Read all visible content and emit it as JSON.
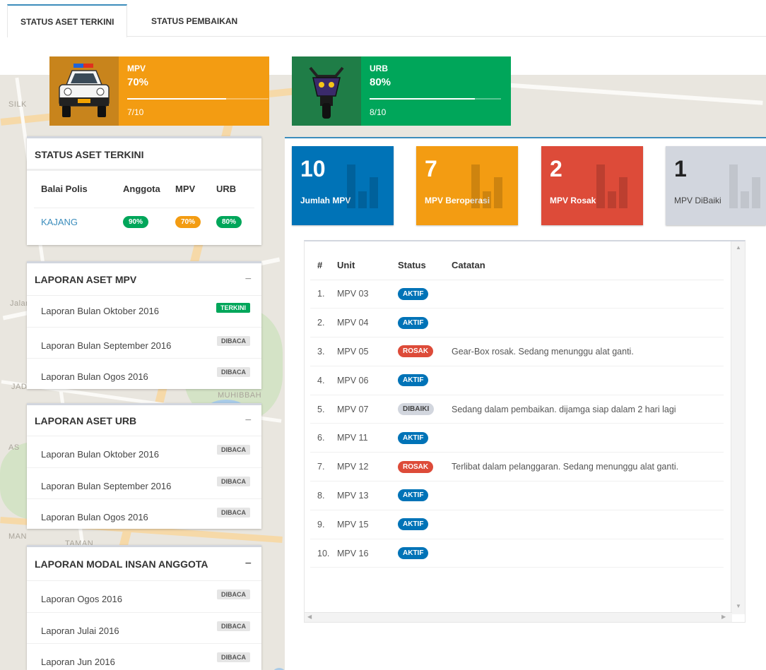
{
  "tabs": [
    {
      "label": "STATUS ASET TERKINI",
      "active": true
    },
    {
      "label": "STATUS PEMBAIKAN",
      "active": false
    }
  ],
  "asset_progress": [
    {
      "name": "MPV",
      "percent_label": "70%",
      "ratio": "7/10",
      "fill": 0.7,
      "color": "#f39c12",
      "icon_color": "#c8841c",
      "icon": "police-car-icon"
    },
    {
      "name": "URB",
      "percent_label": "80%",
      "ratio": "8/10",
      "fill": 0.8,
      "color": "#00a65a",
      "icon_color": "#1f7d47",
      "icon": "motorcycle-icon"
    }
  ],
  "status_panel": {
    "title": "STATUS ASET TERKINI",
    "headers": [
      "Balai Polis",
      "Anggota",
      "MPV",
      "URB"
    ],
    "rows": [
      {
        "station": "KAJANG",
        "anggota": "90%",
        "mpv": "70%",
        "urb": "80%"
      }
    ]
  },
  "report_panels": [
    {
      "title": "LAPORAN ASET MPV",
      "items": [
        {
          "label": "Laporan Bulan Oktober 2016",
          "badge": "TERKINI"
        },
        {
          "label": "Laporan Bulan September 2016",
          "badge": "DIBACA"
        },
        {
          "label": "Laporan Bulan Ogos 2016",
          "badge": "DIBACA"
        }
      ]
    },
    {
      "title": "LAPORAN ASET URB",
      "items": [
        {
          "label": "Laporan Bulan Oktober 2016",
          "badge": "DIBACA"
        },
        {
          "label": "Laporan Bulan September 2016",
          "badge": "DIBACA"
        },
        {
          "label": "Laporan Bulan Ogos 2016",
          "badge": "DIBACA"
        }
      ]
    },
    {
      "title": "LAPORAN MODAL INSAN ANGGOTA",
      "items": [
        {
          "label": "Laporan Ogos 2016",
          "badge": "DIBACA"
        },
        {
          "label": "Laporan Julai 2016",
          "badge": "DIBACA"
        },
        {
          "label": "Laporan Jun 2016",
          "badge": "DIBACA"
        }
      ]
    }
  ],
  "collapse_symbol": "−",
  "stat_boxes": [
    {
      "number": "10",
      "label": "Jumlah MPV",
      "color": "#0073b7"
    },
    {
      "number": "7",
      "label": "MPV Beroperasi",
      "color": "#f39c12"
    },
    {
      "number": "2",
      "label": "MPV Rosak",
      "color": "#dd4b39"
    },
    {
      "number": "1",
      "label": "MPV DiBaiki",
      "color": "#d2d6de"
    }
  ],
  "units_table": {
    "headers": [
      "#",
      "Unit",
      "Status",
      "Catatan"
    ],
    "rows": [
      {
        "no": "1.",
        "unit": "MPV 03",
        "status": "AKTIF",
        "note": ""
      },
      {
        "no": "2.",
        "unit": "MPV 04",
        "status": "AKTIF",
        "note": ""
      },
      {
        "no": "3.",
        "unit": "MPV 05",
        "status": "ROSAK",
        "note": "Gear-Box rosak. Sedang menunggu alat ganti."
      },
      {
        "no": "4.",
        "unit": "MPV 06",
        "status": "AKTIF",
        "note": ""
      },
      {
        "no": "5.",
        "unit": "MPV 07",
        "status": "DIBAIKI",
        "note": "Sedang dalam pembaikan. dijamga siap dalam 2 hari lagi"
      },
      {
        "no": "6.",
        "unit": "MPV 11",
        "status": "AKTIF",
        "note": ""
      },
      {
        "no": "7.",
        "unit": "MPV 12",
        "status": "ROSAK",
        "note": "Terlibat dalam pelanggaran. Sedang menunggu alat ganti."
      },
      {
        "no": "8.",
        "unit": "MPV 13",
        "status": "AKTIF",
        "note": ""
      },
      {
        "no": "9.",
        "unit": "MPV 15",
        "status": "AKTIF",
        "note": ""
      },
      {
        "no": "10.",
        "unit": "MPV 16",
        "status": "AKTIF",
        "note": ""
      }
    ]
  },
  "status_colors": {
    "AKTIF": "#0073b7",
    "ROSAK": "#dd4b39",
    "DIBAIKI": "#d2d6de",
    "green": "#00a65a",
    "orange": "#f39c12"
  },
  "map_labels": [
    "SILK",
    "JADE HILLS",
    "MUHIBBAH",
    "TAMAN",
    "Jalan",
    "AS",
    "MAN"
  ]
}
